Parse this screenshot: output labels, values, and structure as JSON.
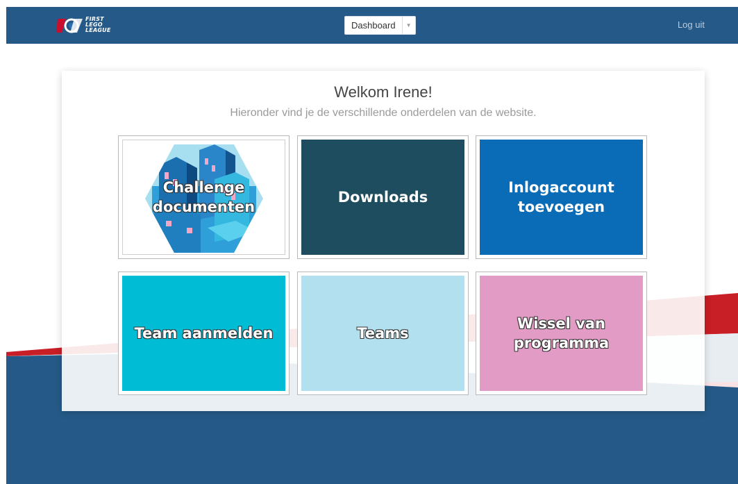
{
  "header": {
    "logo_lines": [
      "FIRST",
      "LEGO",
      "LEAGUE"
    ],
    "dashboard_label": "Dashboard",
    "logout_label": "Log uit"
  },
  "main": {
    "welcome": "Welkom Irene!",
    "subtitle": "Hieronder vind je de verschillende onderdelen van de website."
  },
  "tiles": [
    {
      "label": "Challenge documenten",
      "color": "#ffffff"
    },
    {
      "label": "Downloads",
      "color": "#1e4d5f"
    },
    {
      "label": "Inlogaccount toevoegen",
      "color": "#0a6bb7"
    },
    {
      "label": "Team aanmelden",
      "color": "#00bcd4"
    },
    {
      "label": "Teams",
      "color": "#b3e0ee"
    },
    {
      "label": "Wissel van programma",
      "color": "#e29bc4"
    }
  ],
  "colors": {
    "navbar": "#255a88",
    "accent_red": "#c8102e",
    "footer_blue": "#255a88"
  },
  "icons": {
    "logo": "first-lego-league-logo",
    "caret": "caret-down-icon"
  }
}
